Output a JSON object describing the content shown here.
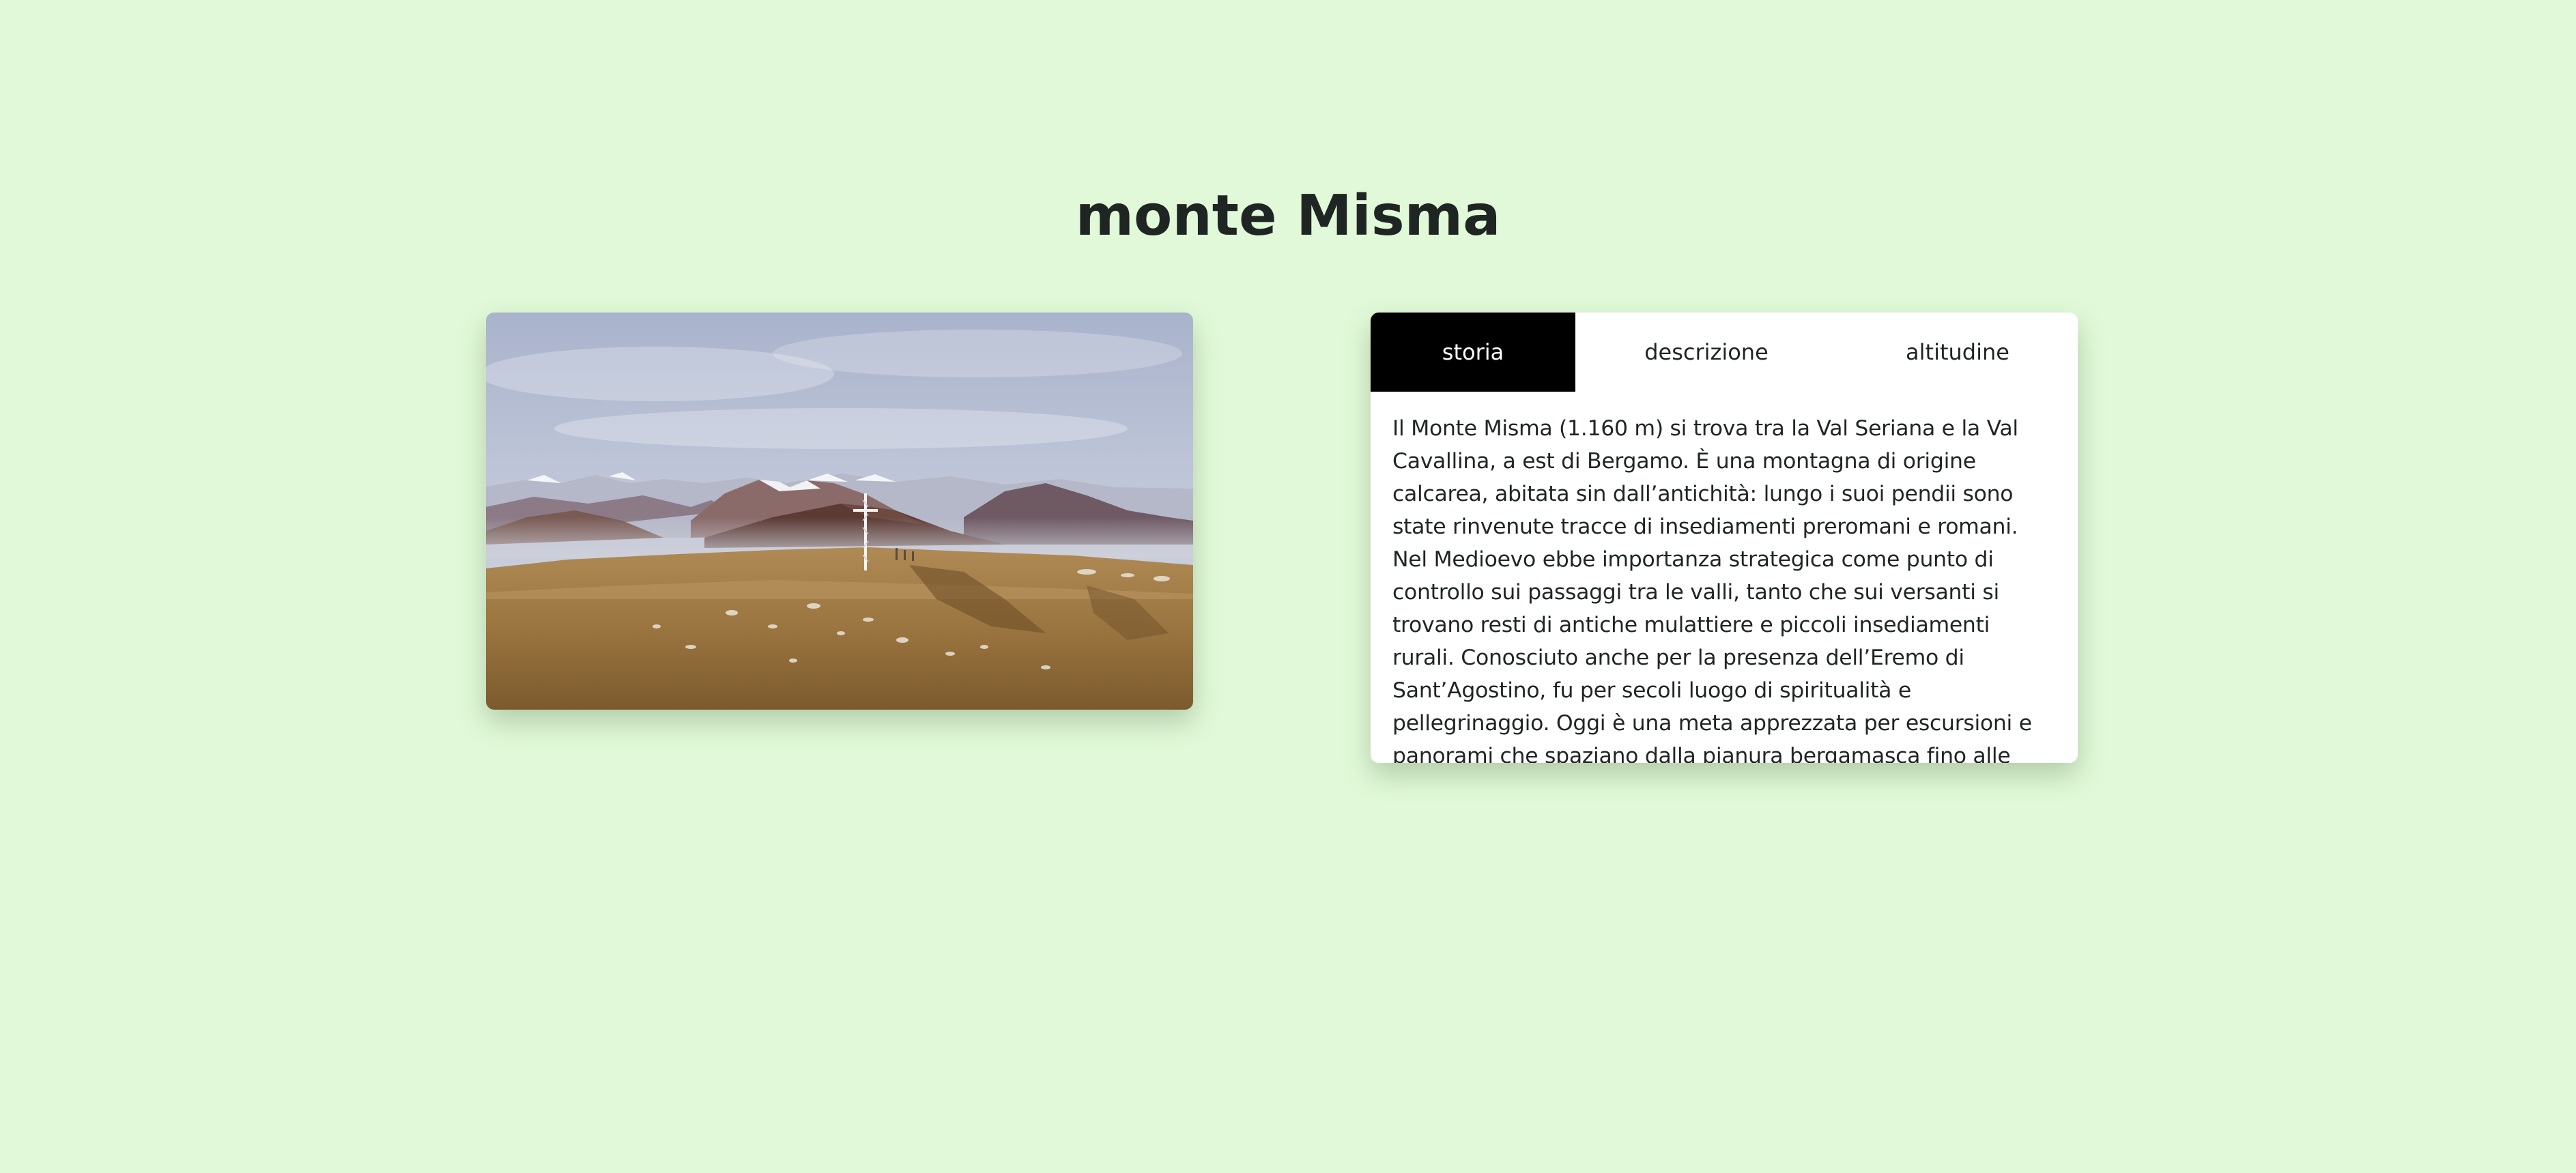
{
  "page": {
    "title": "monte Misma"
  },
  "photo": {
    "subject": "panoramic view from the summit of monte Misma with a summit cross, brown grassy foreground, distant mountains with snowy peaks under a cloudy sky"
  },
  "tabs": [
    {
      "label": "storia",
      "active": true
    },
    {
      "label": "descrizione",
      "active": false
    },
    {
      "label": "altitudine",
      "active": false
    }
  ],
  "panel": {
    "text": "Il Monte Misma (1.160 m) si trova tra la Val Seriana e la Val Cavallina, a est di Bergamo. È una montagna di origine calcarea, abitata sin dall’antichità: lungo i suoi pendii sono state rinvenute tracce di insediamenti preromani e romani. Nel Medioevo ebbe importanza strategica come punto di controllo sui passaggi tra le valli, tanto che sui versanti si trovano resti di antiche mulattiere e piccoli insediamenti rurali. Conosciuto anche per la presenza dell’Eremo di Sant’Agostino, fu per secoli luogo di spiritualità e pellegrinaggio. Oggi è una meta apprezzata per escursioni e panorami che spaziano dalla pianura bergamasca fino alle Prealpi."
  },
  "colors": {
    "background": "#e1f9d8",
    "active_tab_bg": "#000000",
    "active_tab_text": "#ffffff",
    "text": "#1f2523"
  }
}
